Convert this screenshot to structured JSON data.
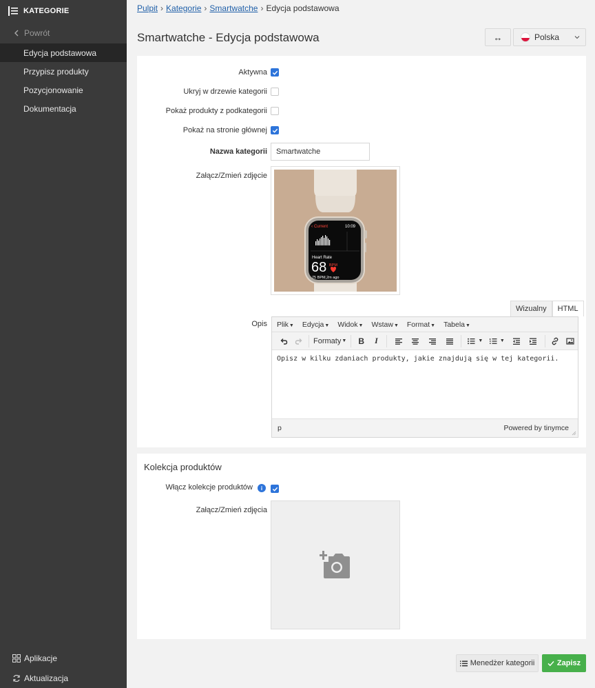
{
  "sidebar": {
    "title": "KATEGORIE",
    "back_label": "Powrót",
    "items": [
      {
        "label": "Edycja podstawowa"
      },
      {
        "label": "Przypisz produkty"
      },
      {
        "label": "Pozycjonowanie"
      },
      {
        "label": "Dokumentacja"
      }
    ],
    "bottom": {
      "apps": "Aplikacje",
      "updates": "Aktualizacja"
    }
  },
  "breadcrumb": {
    "home": "Pulpit",
    "categories": "Kategorie",
    "current_link": "Smartwatche",
    "current": "Edycja podstawowa",
    "sep": "›"
  },
  "header": {
    "title": "Smartwatche - Edycja podstawowa",
    "arrows": "↔",
    "language": "Polska"
  },
  "form": {
    "active_label": "Aktywna",
    "hide_label": "Ukryj w drzewie kategorii",
    "show_sub_label": "Pokaż produkty z podkategorii",
    "show_home_label": "Pokaż na stronie głównej",
    "name_label": "Nazwa kategorii",
    "name_value": "Smartwatche",
    "photo_label": "Załącz/Zmień zdjęcie",
    "desc_label": "Opis"
  },
  "watch_screen": {
    "back": "Current",
    "time": "10:09",
    "metric": "Heart Rate",
    "value": "68",
    "unit": "BPM",
    "footer": "75 BPM,2m ago"
  },
  "editor": {
    "tabs": {
      "visual": "Wizualny",
      "html": "HTML"
    },
    "menus": [
      "Plik",
      "Edycja",
      "Widok",
      "Wstaw",
      "Format",
      "Tabela"
    ],
    "formats_label": "Formaty",
    "bold": "B",
    "italic": "I",
    "content": "Opisz w kilku zdaniach produkty, jakie znajdują się w tej kategorii.",
    "status_path": "p",
    "powered": "Powered by tinymce"
  },
  "collection": {
    "title": "Kolekcja produktów",
    "enable_label": "Włącz kolekcje produktów",
    "info": "i",
    "photos_label": "Załącz/Zmień zdjęcia"
  },
  "footer": {
    "manager_label": "Menedżer kategorii",
    "save_label": "Zapisz"
  }
}
